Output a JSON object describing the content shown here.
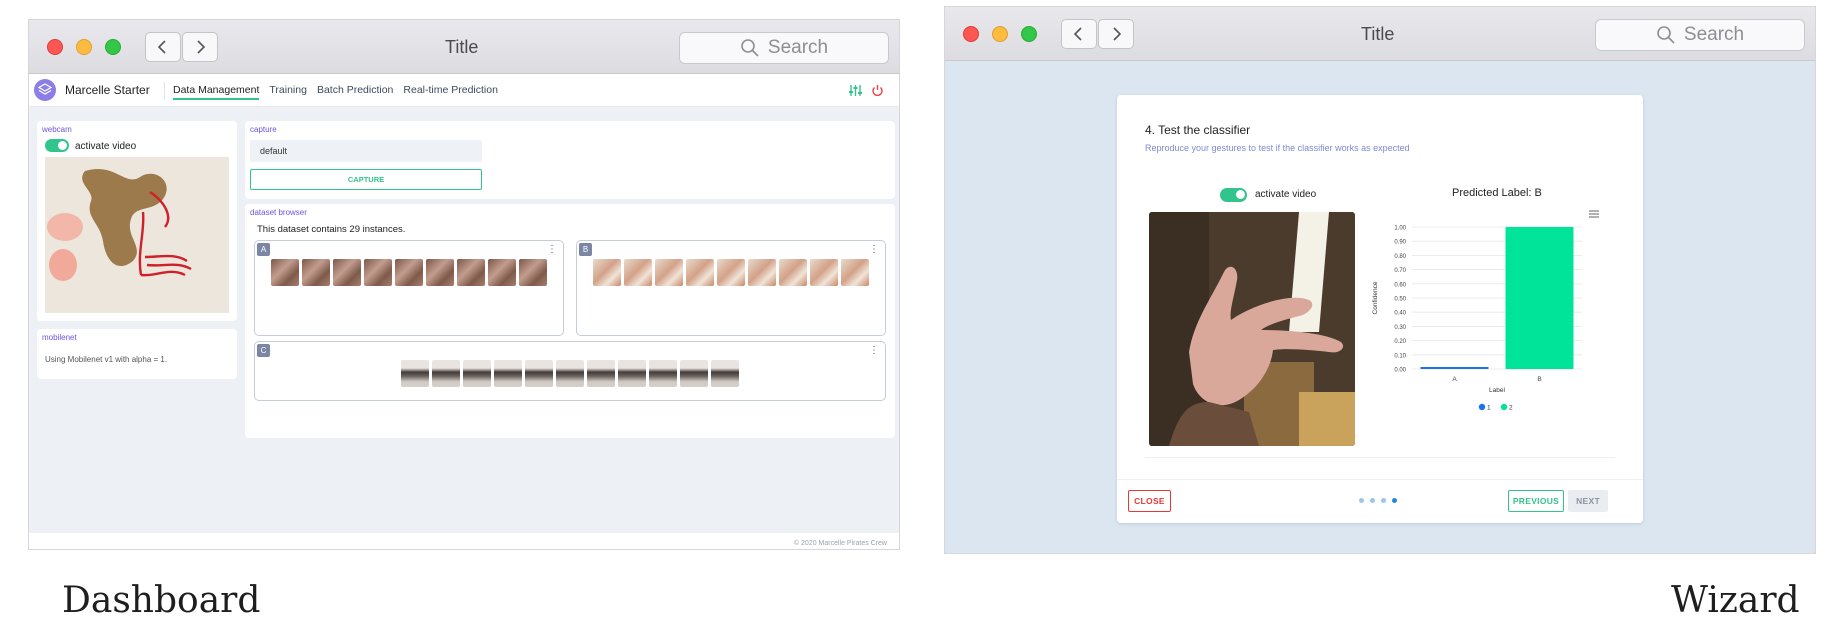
{
  "dashboard": {
    "window_title": "Title",
    "search_placeholder": "Search",
    "app_name": "Marcelle Starter",
    "tabs": [
      "Data Management",
      "Training",
      "Batch Prediction",
      "Real-time Prediction"
    ],
    "webcam": {
      "title": "webcam",
      "toggle_label": "activate video"
    },
    "mobilenet": {
      "title": "mobilenet",
      "text": "Using Mobilenet v1 with alpha = 1."
    },
    "capture": {
      "title": "capture",
      "input_value": "default",
      "button_label": "CAPTURE"
    },
    "dataset_browser": {
      "title": "dataset browser",
      "summary": "This dataset contains 29 instances.",
      "classes": [
        {
          "label": "A",
          "count": 9
        },
        {
          "label": "B",
          "count": 9
        },
        {
          "label": "C",
          "count": 11
        }
      ]
    },
    "footer": "© 2020 Marcelle Pirates Crew",
    "caption": "Dashboard"
  },
  "wizard": {
    "window_title": "Title",
    "search_placeholder": "Search",
    "step_title": "4. Test the classifier",
    "step_subtitle": "Reproduce your gestures to test if the classifier works as expected",
    "toggle_label": "activate video",
    "prediction_title": "Predicted Label: B",
    "buttons": {
      "close": "CLOSE",
      "previous": "PREVIOUS",
      "next": "NEXT"
    },
    "dots": {
      "total": 4,
      "active": 4
    },
    "caption": "Wizard"
  },
  "colors": {
    "accent": "#31c48d",
    "chart_bar_b": "#00e49a",
    "chart_bar_a": "#1a73e8",
    "close": "#e53935",
    "purple": "#6b57e0"
  },
  "chart_data": {
    "type": "bar",
    "categories": [
      "A",
      "B"
    ],
    "values": [
      0.01,
      1.0
    ],
    "series": [
      {
        "name": "1",
        "values": [
          0.01,
          null
        ]
      },
      {
        "name": "2",
        "values": [
          null,
          1.0
        ]
      }
    ],
    "xlabel": "Label",
    "ylabel": "Confidence",
    "ylim": [
      0,
      1
    ],
    "yticks": [
      "0.00",
      "0.10",
      "0.20",
      "0.30",
      "0.40",
      "0.50",
      "0.60",
      "0.70",
      "0.80",
      "0.90",
      "1.00"
    ],
    "legend": "bottom",
    "grid": true
  }
}
